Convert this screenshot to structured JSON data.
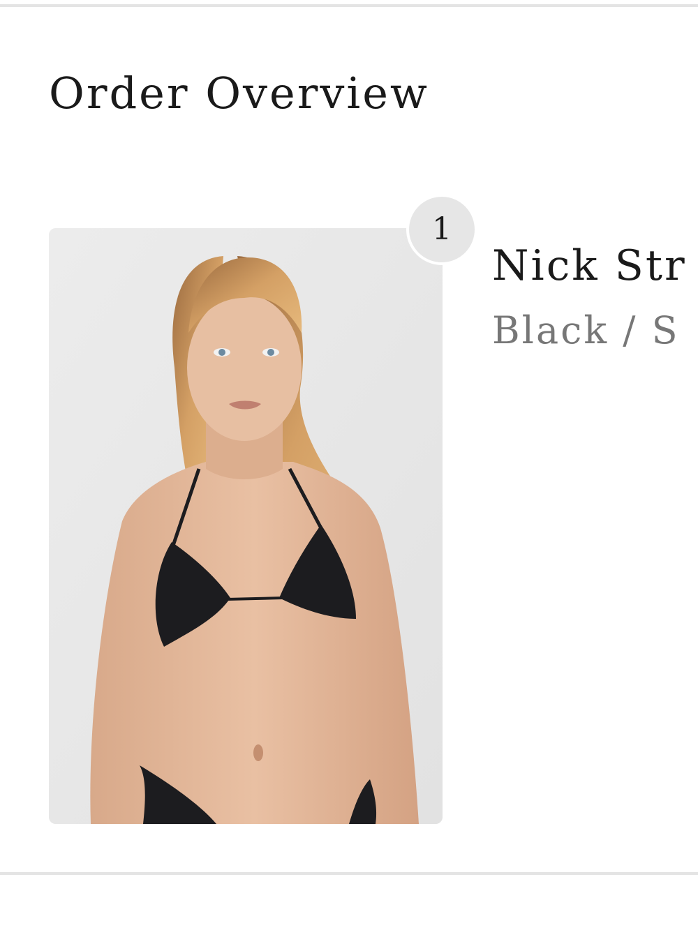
{
  "order": {
    "title": "Order Overview",
    "items": [
      {
        "quantity": "1",
        "name": "Nick Str",
        "variant": "Black / S"
      }
    ]
  }
}
